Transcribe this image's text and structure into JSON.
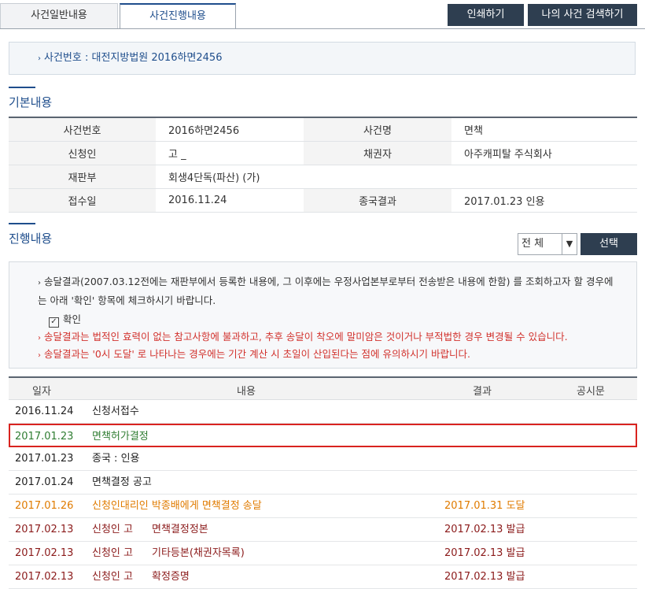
{
  "tabs": [
    {
      "label": "사건일반내용",
      "active": false
    },
    {
      "label": "사건진행내용",
      "active": true
    }
  ],
  "buttons": {
    "print": "인쇄하기",
    "my_search": "나의 사건 검색하기",
    "select": "선택"
  },
  "case_number_line": "사건번호 : 대전지방법원 2016하면2456",
  "basic_section": {
    "title": "기본내용",
    "rows": [
      [
        {
          "label": "사건번호",
          "value": "2016하면2456"
        },
        {
          "label": "사건명",
          "value": "면책"
        }
      ],
      [
        {
          "label": "신청인",
          "value": "고  _"
        },
        {
          "label": "채권자",
          "value": "아주캐피탈 주식회사"
        }
      ],
      [
        {
          "label": "재판부",
          "value": "회생4단독(파산) (가)"
        }
      ],
      [
        {
          "label": "접수일",
          "value": "2016.11.24"
        },
        {
          "label": "종국결과",
          "value": "2017.01.23 인용"
        }
      ]
    ]
  },
  "progress_section": {
    "title": "진행내용",
    "filter_value": "전 체",
    "notice_text": "송달결과(2007.03.12전에는 재판부에서 등록한 내용에, 그 이후에는 우정사업본부로부터 전송받은 내용에 한함) 를 조회하고자 할 경우에는 아래 '확인' 항목에 체크하시기 바랍니다.",
    "checkbox_label": "확인",
    "warning_1": "송달결과는 법적인 효력이 없는 참고사항에 불과하고, 추후 송달이 착오에 말미암은 것이거나 부적법한 경우 변경될 수 있습니다.",
    "warning_2": "송달결과는 '0시 도달' 로 나타나는 경우에는 기간 계산 시 초일이 산입된다는 점에 유의하시기 바랍니다.",
    "headers": {
      "date": "일자",
      "content": "내용",
      "result": "결과",
      "notice": "공시문"
    },
    "rows": [
      {
        "date": "2016.11.24",
        "content": "신청서접수",
        "result": "",
        "color": "#222222"
      },
      {
        "date": "2017.01.23",
        "content": "면책허가결정",
        "result": "",
        "color": "#2f7d32"
      },
      {
        "date": "2017.01.23",
        "content": "종국 : 인용",
        "result": "",
        "color": "#222222"
      },
      {
        "date": "2017.01.24",
        "content": "면책결정 공고",
        "result": "",
        "color": "#222222"
      },
      {
        "date": "2017.01.26",
        "content": "신청인대리인 박종배에게 면책결정 송달",
        "result": "2017.01.31 도달",
        "color": "#e07b00"
      },
      {
        "date": "2017.02.13",
        "content": "신청인 고",
        "content2": "면책결정정본",
        "result": "2017.02.13 발급",
        "color": "#8b1a1a"
      },
      {
        "date": "2017.02.13",
        "content": "신청인 고",
        "content2": "기타등본(채권자목록)",
        "result": "2017.02.13 발급",
        "color": "#8b1a1a"
      },
      {
        "date": "2017.02.13",
        "content": "신청인 고",
        "content2": "확정증명",
        "result": "2017.02.13 발급",
        "color": "#8b1a1a"
      }
    ]
  }
}
